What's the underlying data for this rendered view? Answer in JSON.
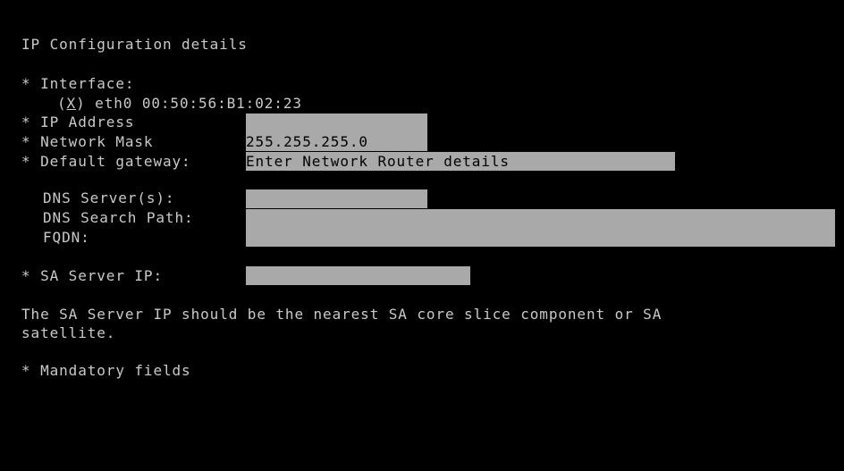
{
  "title": "IP Configuration details",
  "interface": {
    "label": "* Interface:",
    "option_prefix": "(",
    "option_mark": "X",
    "option_suffix": ") eth0 00:50:56:B1:02:23"
  },
  "fields": {
    "ip_address": {
      "label": "* IP Address",
      "value": ""
    },
    "network_mask": {
      "label": "* Network Mask",
      "value": "255.255.255.0"
    },
    "default_gateway": {
      "label": "* Default gateway:",
      "value": "Enter Network Router details"
    },
    "dns_servers": {
      "label": "DNS Server(s):",
      "value": ""
    },
    "dns_search_path": {
      "label": "DNS Search Path:",
      "value": ""
    },
    "fqdn": {
      "label": "FQDN:",
      "value": ""
    },
    "sa_server_ip": {
      "label": "* SA Server IP:",
      "value": ""
    }
  },
  "help_text_line1": "The SA Server IP should be the nearest SA core slice component or SA",
  "help_text_line2": "satellite.",
  "footer_note": "* Mandatory fields",
  "colors": {
    "background": "#000000",
    "text": "#c9c9c9",
    "field_background": "#a9a9a9",
    "field_text": "#000000"
  }
}
